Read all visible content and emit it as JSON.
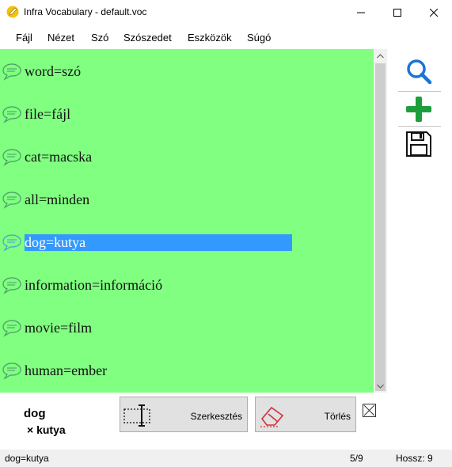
{
  "window": {
    "title": "Infra Vocabulary - default.voc",
    "app_icon": "pencil-icon",
    "controls": [
      "minimize-icon",
      "maximize-icon",
      "close-icon"
    ]
  },
  "menu": [
    "Fájl",
    "Nézet",
    "Szó",
    "Szószedet",
    "Eszközök",
    "Súgó"
  ],
  "list": {
    "background": "#80ff80",
    "selection_color": "#3399ff",
    "items": [
      {
        "text": "word=szó"
      },
      {
        "text": "file=fájl"
      },
      {
        "text": "cat=macska"
      },
      {
        "text": "all=minden"
      },
      {
        "text": "dog=kutya",
        "selected": true
      },
      {
        "text": "information=információ"
      },
      {
        "text": "movie=film"
      },
      {
        "text": "human=ember"
      }
    ]
  },
  "toolbar": {
    "icons": [
      "search-icon",
      "add-icon",
      "save-icon"
    ],
    "accent_search": "#1a73d9",
    "accent_add": "#1e9e3a"
  },
  "detail": {
    "word": "dog",
    "translation": "× kutya",
    "edit_label": "Szerkesztés",
    "delete_label": "Törlés"
  },
  "status": {
    "text": "dog=kutya",
    "position": "5/9",
    "length": "Hossz: 9"
  }
}
